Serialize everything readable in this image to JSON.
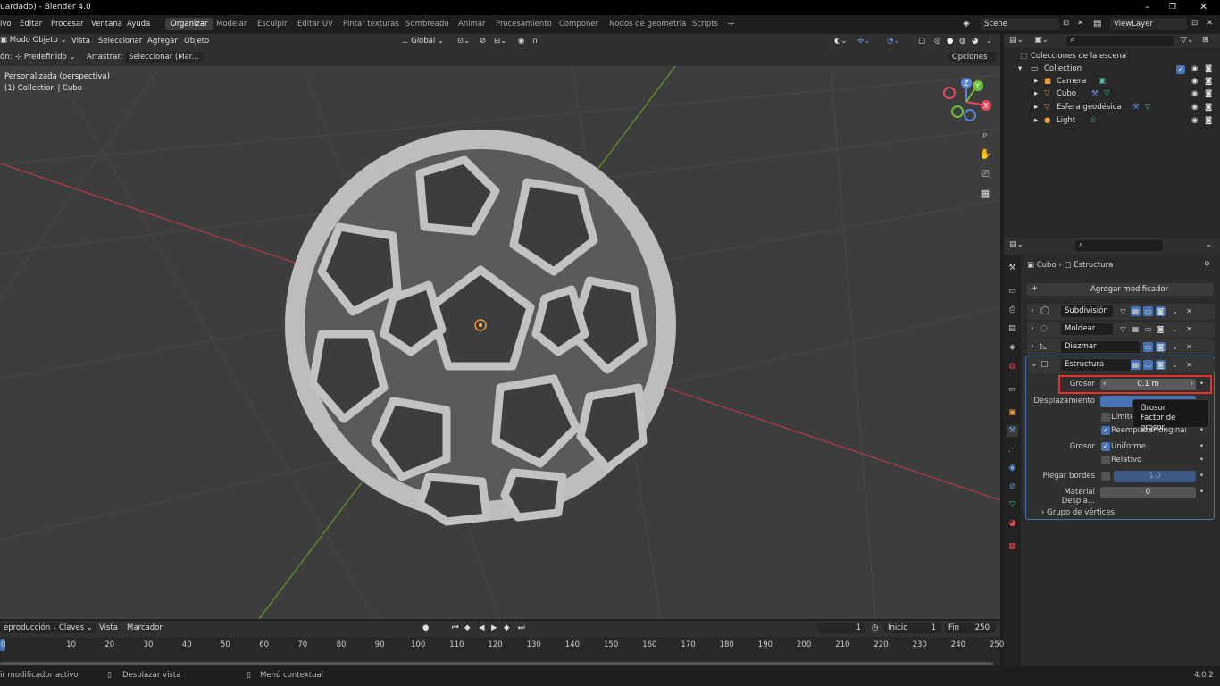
{
  "window": {
    "title": "uardado) - Blender 4.0",
    "controls": [
      "–",
      "❐",
      "✕"
    ]
  },
  "menubar": {
    "menus": [
      "ivo",
      "Editar",
      "Procesar",
      "Ventana",
      "Ayuda"
    ],
    "workspaces": [
      "Organizar",
      "Modelar",
      "Esculpir",
      "Editar UV",
      "Pintar texturas",
      "Sombreado",
      "Animar",
      "Procesamiento",
      "Componer",
      "Nodos de geometría",
      "Scripts",
      "+"
    ],
    "active_workspace": "Organizar",
    "scene": "Scene",
    "view_layer": "ViewLayer"
  },
  "viewport_header": {
    "mode": "Modo Objeto",
    "menus": [
      "Vista",
      "Seleccionar",
      "Agregar",
      "Objeto"
    ],
    "orientation": "Global",
    "options": "Opciones"
  },
  "tool_header": {
    "prefix": "ón:",
    "orientation_label": "Predefinido",
    "drag_label": "Arrastrar:",
    "drag_value": "Seleccionar (Mar..."
  },
  "viewport": {
    "overlay_line1": "Personalizada (perspectiva)",
    "overlay_line2": "(1) Collection | Cubo",
    "gizmo": {
      "z": "Z",
      "y": "Y",
      "x": "X"
    }
  },
  "outliner": {
    "root": "Colecciones de la escena",
    "collection": "Collection",
    "items": [
      {
        "name": "Camera",
        "icon": "camera-icon"
      },
      {
        "name": "Cubo",
        "icon": "mesh-icon"
      },
      {
        "name": "Esfera geodésica",
        "icon": "mesh-icon"
      },
      {
        "name": "Light",
        "icon": "light-icon"
      }
    ]
  },
  "properties": {
    "breadcrumb_object": "Cubo",
    "breadcrumb_modifier": "Estructura",
    "add_modifier": "Agregar modificador",
    "modifiers": [
      {
        "name": "Subdivisión",
        "expanded": false
      },
      {
        "name": "Moldear",
        "expanded": false
      },
      {
        "name": "Diezmar",
        "expanded": false
      },
      {
        "name": "Estructura",
        "expanded": true
      }
    ],
    "panel": {
      "grosor_label": "Grosor",
      "grosor_value": "0.1 m",
      "desplazamiento_label": "Desplazamiento",
      "limite_label": "Límite",
      "reemplazar_label": "Reemplazar original",
      "grosor2_label": "Grosor",
      "uniforme_label": "Uniforme",
      "relativo_label": "Relativo",
      "plegar_label": "Plegar bordes",
      "plegar_value": "1.0",
      "material_label": "Material Despla...",
      "material_value": "0",
      "grupo_label": "Grupo de vértices"
    },
    "tooltip": {
      "title": "Grosor",
      "desc": "Factor de grosor."
    }
  },
  "timeline": {
    "playback": "eproducción",
    "keys": "Claves",
    "view": "Vista",
    "marker": "Marcador",
    "current_frame": "1",
    "start_label": "Inicio",
    "start_value": "1",
    "end_label": "Fin",
    "end_value": "250",
    "ticks": [
      "0",
      "10",
      "20",
      "30",
      "40",
      "50",
      "60",
      "70",
      "80",
      "90",
      "100",
      "110",
      "120",
      "130",
      "140",
      "150",
      "160",
      "170",
      "180",
      "190",
      "200",
      "210",
      "220",
      "230",
      "240",
      "250"
    ]
  },
  "statusbar": {
    "left": "ir modificador activo",
    "mid": "Desplazar vista",
    "right": "Menú contextual",
    "version": "4.0.2"
  }
}
